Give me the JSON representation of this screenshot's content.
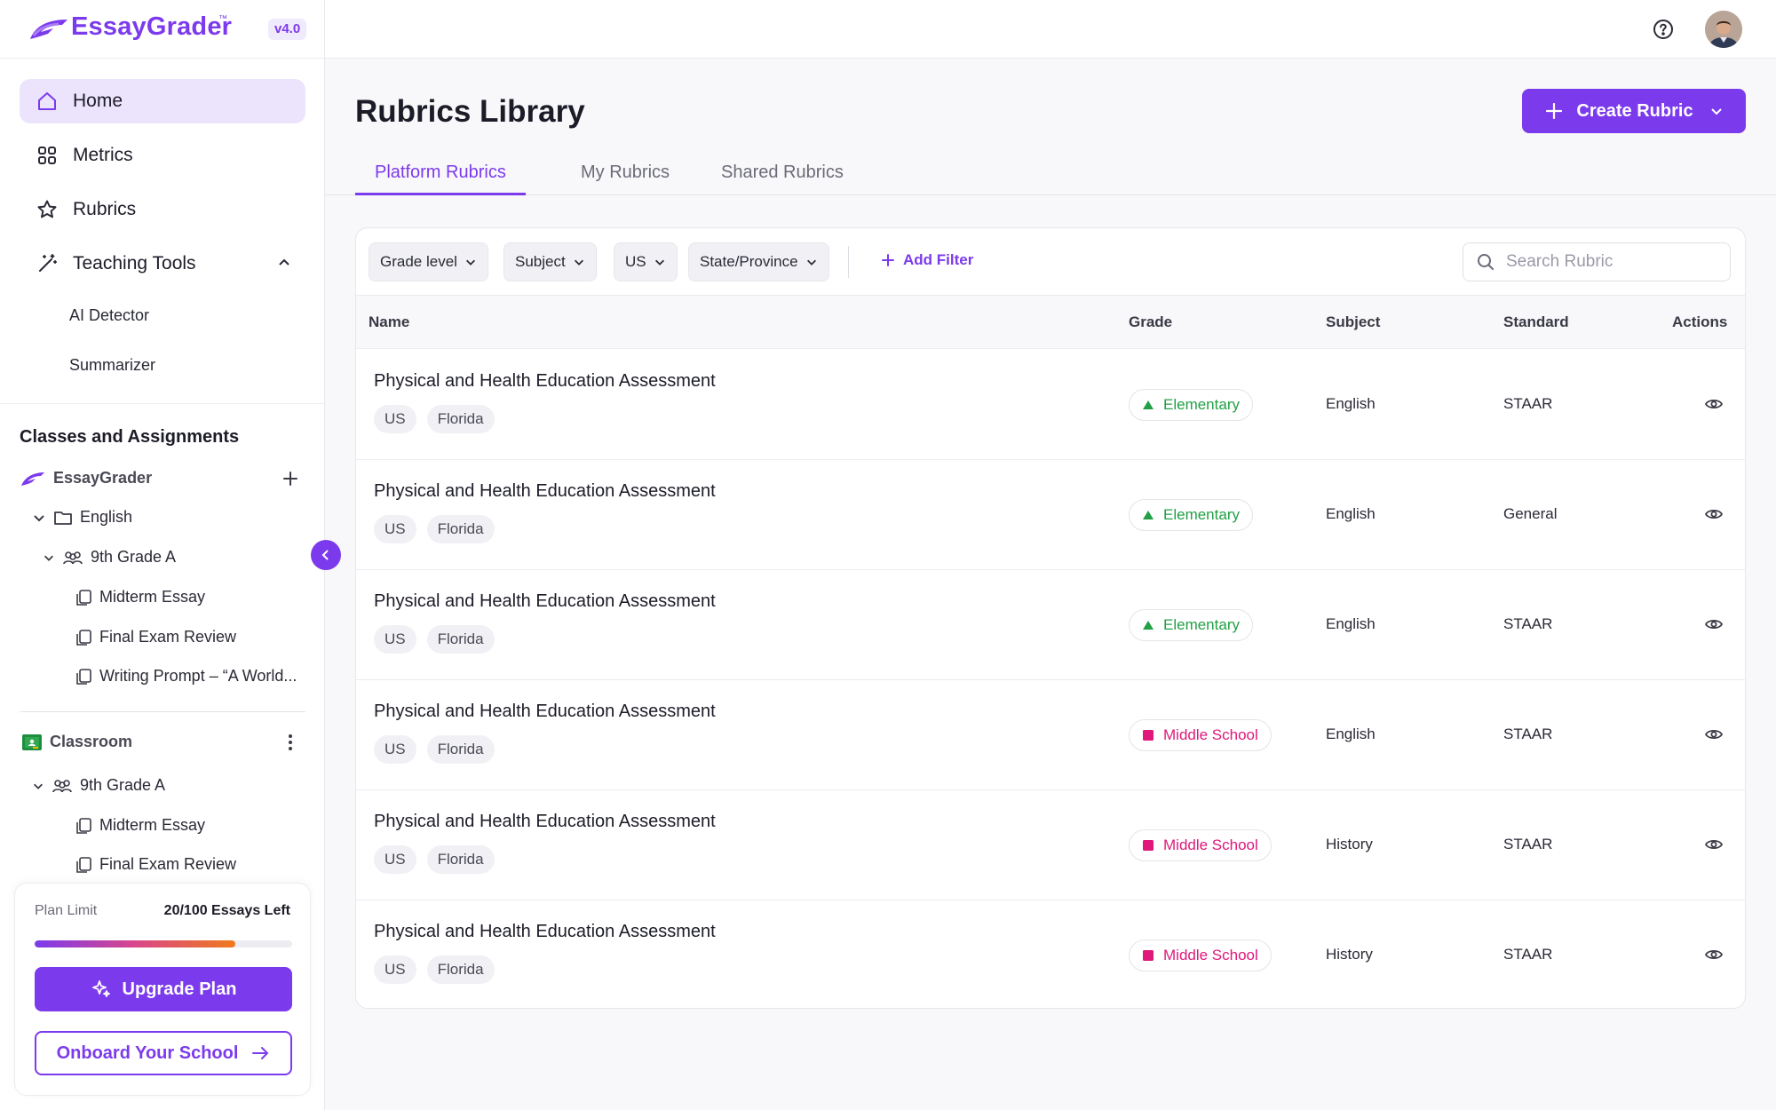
{
  "brand": {
    "name": "EssayGrader",
    "tm": "™",
    "version": "v4.0"
  },
  "nav": {
    "home": "Home",
    "metrics": "Metrics",
    "rubrics": "Rubrics",
    "teaching_tools": "Teaching Tools",
    "ai_detector": "AI Detector",
    "summarizer": "Summarizer"
  },
  "classes": {
    "title": "Classes and Assignments",
    "essaygrader_group": "EssayGrader",
    "english_folder": "English",
    "class_a": "9th Grade A",
    "assignments": [
      "Midterm Essay",
      "Final Exam Review",
      "Writing Prompt – “A World..."
    ],
    "classroom_group": "Classroom",
    "classroom_class": "9th Grade A",
    "classroom_assignments": [
      "Midterm Essay",
      "Final Exam Review"
    ]
  },
  "plan": {
    "label": "Plan Limit",
    "left": "20/100 Essays Left",
    "used_fraction": 0.78,
    "upgrade": "Upgrade Plan",
    "onboard": "Onboard Your School"
  },
  "page": {
    "title": "Rubrics Library",
    "create_button": "Create Rubric",
    "tabs": [
      "Platform Rubrics",
      "My Rubrics",
      "Shared Rubrics"
    ]
  },
  "filters": {
    "grade_level": "Grade level",
    "subject": "Subject",
    "country": "US",
    "state": "State/Province",
    "add_filter": "Add Filter",
    "search_placeholder": "Search Rubric"
  },
  "table": {
    "headers": {
      "name": "Name",
      "grade": "Grade",
      "subject": "Subject",
      "standard": "Standard",
      "actions": "Actions"
    },
    "rows": [
      {
        "name": "Physical and Health Education Assessment",
        "tags": [
          "US",
          "Florida"
        ],
        "grade": "Elementary",
        "subject": "English",
        "standard": "STAAR"
      },
      {
        "name": "Physical and Health Education Assessment",
        "tags": [
          "US",
          "Florida"
        ],
        "grade": "Elementary",
        "subject": "English",
        "standard": "General"
      },
      {
        "name": "Physical and Health Education Assessment",
        "tags": [
          "US",
          "Florida"
        ],
        "grade": "Elementary",
        "subject": "English",
        "standard": "STAAR"
      },
      {
        "name": "Physical and Health Education Assessment",
        "tags": [
          "US",
          "Florida"
        ],
        "grade": "Middle School",
        "subject": "English",
        "standard": "STAAR"
      },
      {
        "name": "Physical and Health Education Assessment",
        "tags": [
          "US",
          "Florida"
        ],
        "grade": "Middle School",
        "subject": "History",
        "standard": "STAAR"
      },
      {
        "name": "Physical and Health Education Assessment",
        "tags": [
          "US",
          "Florida"
        ],
        "grade": "Middle School",
        "subject": "History",
        "standard": "STAAR"
      }
    ]
  },
  "colors": {
    "accent": "#7c3aed",
    "elementary": "#22a045",
    "middle_school": "#e0187a"
  }
}
